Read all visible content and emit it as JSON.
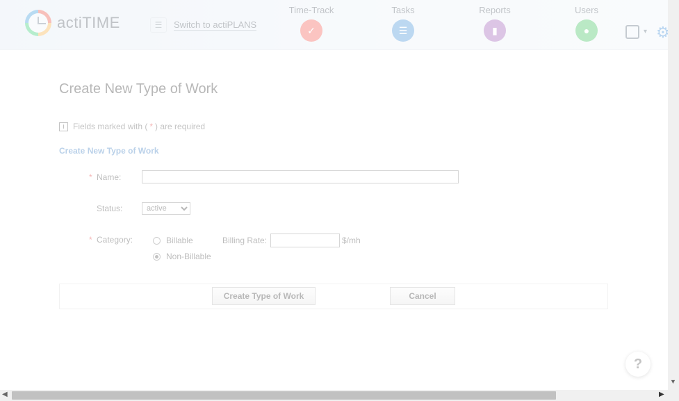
{
  "header": {
    "brand": "actiTIME",
    "switch_label": "Switch to actiPLANS",
    "nav": {
      "timetrack": "Time-Track",
      "tasks": "Tasks",
      "reports": "Reports",
      "users": "Users"
    },
    "nav_colors": {
      "timetrack": "#f2564d",
      "tasks": "#3f8fd8",
      "reports": "#9b59b6",
      "users": "#3bbf5a"
    }
  },
  "page": {
    "title": "Create New Type of Work",
    "required_note_prefix": "Fields marked with (",
    "required_star": "*",
    "required_note_suffix": ") are required",
    "section_title": "Create New Type of Work"
  },
  "form": {
    "name_label": "Name:",
    "name_value": "",
    "status_label": "Status:",
    "status_value": "active",
    "category_label": "Category:",
    "billable_label": "Billable",
    "non_billable_label": "Non-Billable",
    "billing_rate_label": "Billing Rate:",
    "billing_rate_value": "",
    "rate_unit": "$/mh",
    "selected_category": "Non-Billable"
  },
  "buttons": {
    "create": "Create Type of Work",
    "cancel": "Cancel",
    "help": "?"
  },
  "icons": {
    "info": "info-icon",
    "calendar": "calendar-icon",
    "settings": "gear-icon",
    "help": "question-icon"
  }
}
